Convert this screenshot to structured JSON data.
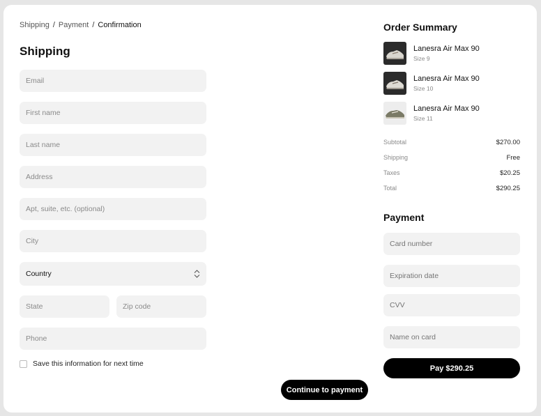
{
  "breadcrumb": {
    "step1": "Shipping",
    "step2": "Payment",
    "step3": "Confirmation",
    "separator": "/"
  },
  "shipping": {
    "title": "Shipping",
    "email_placeholder": "Email",
    "first_name_placeholder": "First name",
    "last_name_placeholder": "Last name",
    "address_placeholder": "Address",
    "apt_placeholder": "Apt, suite, etc. (optional)",
    "city_placeholder": "City",
    "country_value": "Country",
    "state_placeholder": "State",
    "zip_placeholder": "Zip code",
    "phone_placeholder": "Phone",
    "save_info_label": "Save this information for next time",
    "continue_label": "Continue to payment"
  },
  "order_summary": {
    "title": "Order Summary",
    "items": [
      {
        "name": "Lanesra Air Max 90",
        "size": "Size 9"
      },
      {
        "name": "Lanesra Air Max 90",
        "size": "Size 10"
      },
      {
        "name": "Lanesra Air Max 90",
        "size": "Size 11"
      }
    ],
    "subtotal_label": "Subtotal",
    "subtotal_value": "$270.00",
    "shipping_label": "Shipping",
    "shipping_value": "Free",
    "taxes_label": "Taxes",
    "taxes_value": "$20.25",
    "total_label": "Total",
    "total_value": "$290.25"
  },
  "payment": {
    "title": "Payment",
    "card_number_placeholder": "Card number",
    "expiration_placeholder": "Expiration date",
    "cvv_placeholder": "CVV",
    "name_on_card_placeholder": "Name on card",
    "pay_label": "Pay $290.25"
  },
  "icons": {
    "select_chevron": "chevron-up-down-icon",
    "product_image": "sneaker-icon"
  },
  "colors": {
    "accent": "#000000",
    "field_bg": "#f2f2f2",
    "page_bg": "#e6e6e6"
  }
}
